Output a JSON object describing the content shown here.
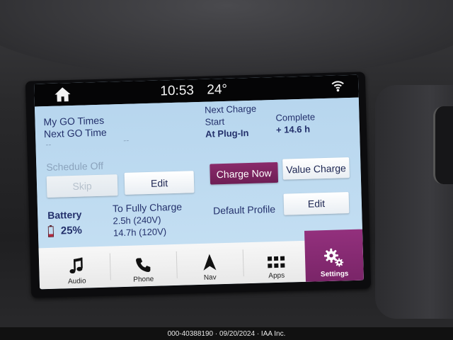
{
  "status_bar": {
    "time": "10:53",
    "temperature": "24°"
  },
  "go_times": {
    "my_go_times_label": "My GO Times",
    "next_go_time_label": "Next GO Time",
    "next_go_time_value": "--",
    "next_go_time_value_2": "--",
    "schedule_status": "Schedule Off",
    "skip_label": "Skip",
    "edit_label": "Edit"
  },
  "next_charge": {
    "heading": "Next Charge",
    "start_label": "Start",
    "start_value": "At Plug-In",
    "complete_label": "Complete",
    "complete_value": "+ 14.6 h",
    "charge_now_label": "Charge Now",
    "value_charge_label": "Value Charge"
  },
  "battery": {
    "label": "Battery",
    "percent": "25%",
    "level_fraction": 0.25,
    "to_full_label": "To Fully Charge",
    "time_240v": "2.5h (240V)",
    "time_120v": "14.7h (120V)"
  },
  "profile": {
    "label": "Default Profile",
    "edit_label": "Edit"
  },
  "nav": {
    "items": [
      {
        "label": "Audio",
        "icon": "music-note-icon"
      },
      {
        "label": "Phone",
        "icon": "phone-icon"
      },
      {
        "label": "Nav",
        "icon": "navigation-arrow-icon"
      },
      {
        "label": "Apps",
        "icon": "apps-grid-icon"
      },
      {
        "label": "Settings",
        "icon": "gears-icon"
      }
    ],
    "active": "Settings"
  },
  "colors": {
    "screen_bg": "#bcd9ef",
    "accent_purple": "#7a2568",
    "text_navy": "#23306b",
    "muted_text": "#8ba3bd"
  },
  "caption": "000-40388190 · 09/20/2024 · IAA Inc."
}
